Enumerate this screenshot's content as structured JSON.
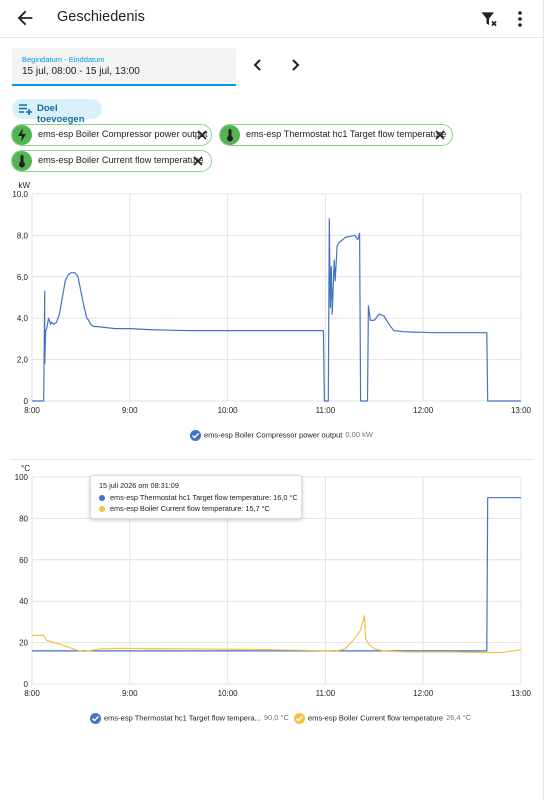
{
  "header": {
    "title": "Geschiedenis"
  },
  "date_field": {
    "label": "Begindatum - Einddatum",
    "value": "15 jul, 08:00 - 15 jul, 13:00"
  },
  "add_target": {
    "label": "Doel toevoegen"
  },
  "chips": [
    {
      "label": "ems-esp Boiler Compressor power output",
      "icon": "flash-icon"
    },
    {
      "label": "ems-esp Thermostat hc1 Target flow temperature",
      "icon": "thermometer-icon"
    },
    {
      "label": "ems-esp Boiler Current flow temperature",
      "icon": "thermometer-icon"
    }
  ],
  "colors": {
    "accent": "#039be5",
    "chip_green": "#54b454",
    "series_blue": "#4472c4",
    "series_yellow": "#f5c342"
  },
  "chart_data": [
    {
      "type": "line",
      "ylabel": "kW",
      "ylim": [
        0,
        10
      ],
      "yticks": [
        "0",
        "2,0",
        "4,0",
        "6,0",
        "8,0",
        "10,0"
      ],
      "xticks": [
        "8:00",
        "9:00",
        "10:00",
        "11:00",
        "12:00",
        "13:00"
      ],
      "xlim": [
        8.0,
        13.0
      ],
      "grid": true,
      "legend_position": "bottom",
      "series": [
        {
          "name": "ems-esp Boiler Compressor power output",
          "value_label": "0,00 kW",
          "color": "#4472c4",
          "x": [
            8.0,
            8.11,
            8.12,
            8.13,
            8.13,
            8.14,
            8.15,
            8.17,
            8.19,
            8.2,
            8.22,
            8.25,
            8.28,
            8.31,
            8.34,
            8.37,
            8.4,
            8.44,
            8.47,
            8.5,
            8.53,
            8.56,
            8.58,
            8.6,
            8.63,
            8.66,
            8.75,
            8.85,
            9.0,
            9.2,
            9.4,
            9.6,
            9.8,
            10.0,
            10.2,
            10.4,
            10.6,
            10.8,
            10.98,
            10.99,
            11.0,
            11.02,
            11.03,
            11.04,
            11.05,
            11.06,
            11.07,
            11.09,
            11.1,
            11.12,
            11.15,
            11.18,
            11.2,
            11.25,
            11.3,
            11.33,
            11.35,
            11.36,
            11.4,
            11.41,
            11.42,
            11.43,
            11.44,
            11.46,
            11.5,
            11.55,
            11.6,
            11.65,
            11.7,
            11.8,
            11.9,
            12.0,
            12.1,
            12.2,
            12.3,
            12.5,
            12.64,
            12.65,
            12.66,
            13.0
          ],
          "y": [
            0,
            0,
            0,
            5.3,
            1.8,
            3.4,
            3.5,
            4.0,
            3.7,
            3.8,
            3.7,
            3.8,
            4.2,
            5.0,
            5.8,
            6.1,
            6.2,
            6.2,
            6.0,
            5.3,
            4.6,
            4.0,
            3.9,
            3.7,
            3.6,
            3.6,
            3.55,
            3.5,
            3.5,
            3.45,
            3.42,
            3.4,
            3.4,
            3.4,
            3.4,
            3.4,
            3.4,
            3.4,
            3.4,
            0,
            0,
            0,
            0,
            8.8,
            4.5,
            6.5,
            4.2,
            6.8,
            5.8,
            7.5,
            7.7,
            7.8,
            7.9,
            7.95,
            8.0,
            7.8,
            8.1,
            0,
            0,
            0,
            0,
            0,
            4.6,
            3.9,
            3.9,
            4.2,
            4.1,
            3.7,
            3.4,
            3.35,
            3.33,
            3.32,
            3.3,
            3.3,
            3.3,
            3.3,
            3.3,
            3.3,
            0,
            0
          ]
        }
      ]
    },
    {
      "type": "line",
      "ylabel": "°C",
      "ylim": [
        0,
        100
      ],
      "yticks": [
        "0",
        "20",
        "40",
        "60",
        "80",
        "100"
      ],
      "xticks": [
        "8:00",
        "9:00",
        "10:00",
        "11:00",
        "12:00",
        "13:00"
      ],
      "xlim": [
        8.0,
        13.0
      ],
      "grid": true,
      "legend_position": "bottom",
      "series": [
        {
          "name": "ems-esp Thermostat hc1 Target flow temperature",
          "legend_label": "ems-esp Thermostat hc1 Target flow tempera...",
          "value_label": "90,0 °C",
          "color": "#4472c4",
          "x": [
            8.0,
            12.65,
            12.66,
            13.0
          ],
          "y": [
            16.0,
            16.0,
            90.0,
            90.0
          ]
        },
        {
          "name": "ems-esp Boiler Current flow temperature",
          "value_label": "26,4 °C",
          "color": "#f5c342",
          "x": [
            8.0,
            8.12,
            8.15,
            8.3,
            8.45,
            8.52,
            8.6,
            8.7,
            8.9,
            9.2,
            9.6,
            10.0,
            10.4,
            10.8,
            11.0,
            11.1,
            11.2,
            11.3,
            11.36,
            11.4,
            11.41,
            11.45,
            11.5,
            11.6,
            11.8,
            12.0,
            12.3,
            12.6,
            12.8,
            13.0
          ],
          "y": [
            23.5,
            23.5,
            21.0,
            19.0,
            16.5,
            15.7,
            16.2,
            17.0,
            17.2,
            17.1,
            17.0,
            16.8,
            16.6,
            16.3,
            16.0,
            15.8,
            17.0,
            22.0,
            26.0,
            33.0,
            22.0,
            19.0,
            17.0,
            16.0,
            15.5,
            15.5,
            15.5,
            15.2,
            15.2,
            16.5
          ]
        }
      ]
    }
  ],
  "tooltip": {
    "title": "15 juli 2026 om 08:31:09",
    "rows": [
      {
        "text": "ems-esp Thermostat hc1 Target flow temperature: 16,0 °C",
        "color": "#4472c4"
      },
      {
        "text": "ems-esp Boiler Current flow temperature: 15,7 °C",
        "color": "#f5c342"
      }
    ]
  }
}
